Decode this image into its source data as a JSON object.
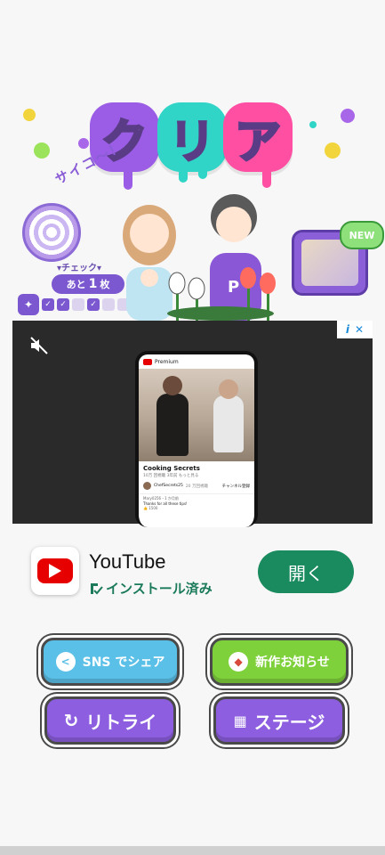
{
  "hero": {
    "title_chars": [
      "ク",
      "リ",
      "ア"
    ],
    "exclaim": "サイコ〜！",
    "check_label": "▾チェック▾",
    "remaining_prefix": "あと",
    "remaining_count": "1",
    "remaining_suffix": "枚",
    "checks": [
      true,
      true,
      false,
      true,
      false,
      false
    ],
    "new_badge": "NEW",
    "colors": {
      "purple": "#9b5de5",
      "cyan": "#30d5c8",
      "pink": "#ff4fa3"
    }
  },
  "ad": {
    "video_app_brand": "Premium",
    "video_title": "Cooking Secrets",
    "video_meta": "10万 回視聴  3年前  もっと見る",
    "channel_name": "ChefSecrets25",
    "channel_subs": "20 万回視聴",
    "subscribe_label": "チャンネル登録",
    "comment_user": "Mary0256・1 か月前",
    "comment_text": "Thanks for all these tips!",
    "comment_likes": "1500",
    "info_icon": "i",
    "close_icon": "✕"
  },
  "app": {
    "name": "YouTube",
    "status": "インストール済み",
    "open_label": "開く",
    "accent": "#1a8a5f"
  },
  "buttons": {
    "share": "SNS でシェア",
    "news": "新作お知らせ",
    "retry": "リトライ",
    "stage": "ステージ"
  }
}
